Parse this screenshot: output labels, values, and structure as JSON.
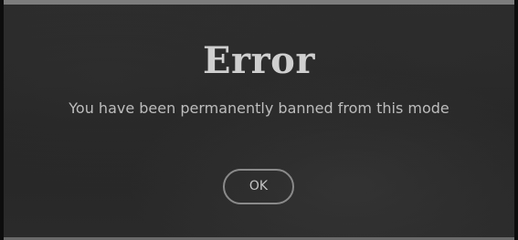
{
  "dialog": {
    "title": "Error",
    "message": "You have been permanently banned from this mode",
    "ok_label": "OK"
  },
  "colors": {
    "background": "#282828",
    "title_text": "#cfcfcf",
    "body_text": "#bdbdbd",
    "button_border": "#8a8a8a",
    "top_border": "#7d7d7d"
  }
}
